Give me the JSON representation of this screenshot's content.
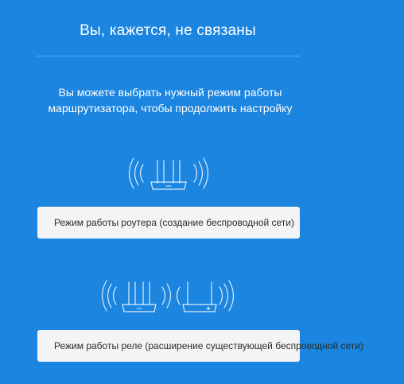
{
  "header": {
    "title": "Вы, кажется, не связаны"
  },
  "main": {
    "description": "Вы можете выбрать нужный режим работы маршрутизатора, чтобы продолжить настройку",
    "modes": [
      {
        "id": "router",
        "label": "Режим работы роутера (создание беспроводной сети)",
        "icon": "router-wifi-icon"
      },
      {
        "id": "repeater",
        "label": "Режим работы реле (расширение существующей беспроводной сети)",
        "icon": "repeater-icon"
      }
    ]
  },
  "colors": {
    "background": "#1b85e0",
    "card": "#f3f4f6",
    "text_light": "#ffffff",
    "text_dark": "#2b2b2b"
  }
}
